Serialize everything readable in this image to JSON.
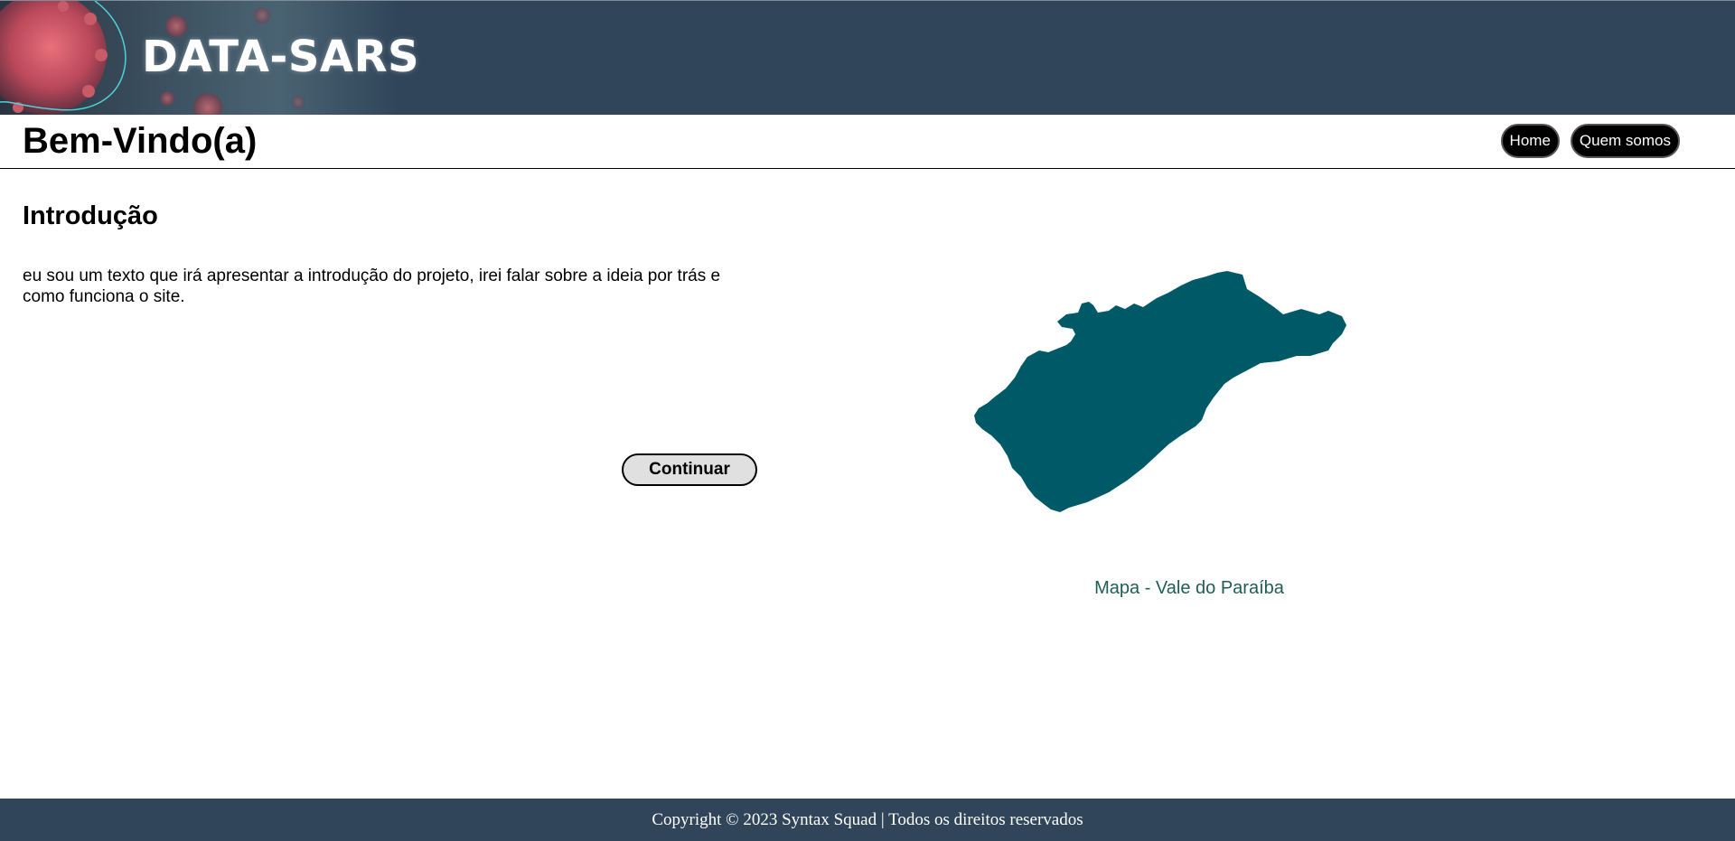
{
  "banner": {
    "brand": "DATA-SARS",
    "art_icon": "virus-illustration"
  },
  "header": {
    "welcome": "Bem-Vindo(a)",
    "nav": [
      {
        "label": "Home"
      },
      {
        "label": "Quem somos"
      }
    ]
  },
  "main": {
    "intro_heading": "Introdução",
    "intro_text": "eu sou um texto que irá apresentar a introdução do projeto, irei falar sobre a ideia por trás e como funciona o site.",
    "continue_label": "Continuar",
    "map_caption": "Mapa - Vale do Paraíba"
  },
  "footer": {
    "copyright": "Copyright © 2023 Syntax Squad | Todos os direitos reservados"
  },
  "colors": {
    "banner_bg": "#30455a",
    "map_fill": "#005966",
    "caption": "#1e5e55",
    "footer_bg": "#30455a"
  }
}
